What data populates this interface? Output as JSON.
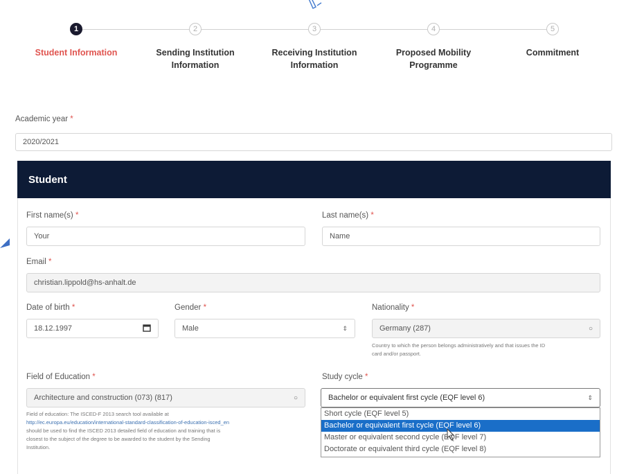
{
  "stepper": {
    "steps": [
      {
        "number": "1",
        "label_line1": "Student Information",
        "label_line2": ""
      },
      {
        "number": "2",
        "label_line1": "Sending Institution",
        "label_line2": "Information"
      },
      {
        "number": "3",
        "label_line1": "Receiving Institution",
        "label_line2": "Information"
      },
      {
        "number": "4",
        "label_line1": "Proposed Mobility",
        "label_line2": "Programme"
      },
      {
        "number": "5",
        "label_line1": "Commitment",
        "label_line2": ""
      }
    ]
  },
  "academic_year": {
    "label": "Academic year",
    "required": "*",
    "value": "2020/2021"
  },
  "student_section": {
    "title": "Student"
  },
  "first_name": {
    "label": "First name(s)",
    "required": "*",
    "value": "Your"
  },
  "last_name": {
    "label": "Last name(s)",
    "required": "*",
    "value": "Name"
  },
  "email": {
    "label": "Email",
    "required": "*",
    "value": "christian.lippold@hs-anhalt.de"
  },
  "date_of_birth": {
    "label": "Date of birth",
    "required": "*",
    "value": "18.12.1997"
  },
  "gender": {
    "label": "Gender",
    "required": "*",
    "value": "Male"
  },
  "nationality": {
    "label": "Nationality",
    "required": "*",
    "value": "Germany (287)",
    "help_line1": "Country to which the person belongs administratively and that issues the ID",
    "help_line2": "card and/or passport."
  },
  "field_of_education": {
    "label": "Field of Education",
    "required": "*",
    "value": "Architecture and construction (073) (817)",
    "help_line1": "Field of education: The ISCED-F 2013 search tool available at",
    "help_link": "http://ec.europa.eu/education/international-standard-classification-of-education-isced_en",
    "help_line3": "should be used to find the ISCED 2013 detailed field of education and training that is",
    "help_line4": "closest to the subject of the degree to be awarded to the student by the Sending",
    "help_line5": "Institution."
  },
  "study_cycle": {
    "label": "Study cycle",
    "required": "*",
    "value": "Bachelor or equivalent first cycle (EQF level 6)",
    "options": [
      "Short cycle (EQF level 5)",
      "Bachelor or equivalent first cycle (EQF level 6)",
      "Master or equivalent second cycle (EQF level 7)",
      "Doctorate or equivalent third cycle (EQF level 8)"
    ],
    "selected_index": 1
  },
  "colors": {
    "accent": "#e05550",
    "header_bg": "#0d1b36",
    "highlight": "#1a6ec8"
  }
}
